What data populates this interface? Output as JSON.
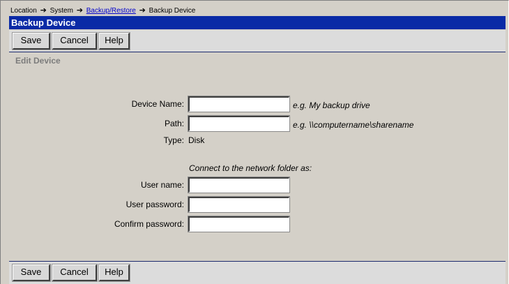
{
  "breadcrumb": {
    "location": "Location",
    "system": "System",
    "backup_restore": "Backup/Restore",
    "current": "Backup Device"
  },
  "title": "Backup Device",
  "toolbar": {
    "save_label": "Save",
    "cancel_label": "Cancel",
    "help_label": "Help"
  },
  "section_title": "Edit Device",
  "form": {
    "device_name": {
      "label": "Device Name:",
      "value": "",
      "hint": "e.g. My backup drive"
    },
    "path": {
      "label": "Path:",
      "value": "",
      "hint": "e.g. \\\\computername\\sharename"
    },
    "type": {
      "label": "Type:",
      "value": "Disk"
    },
    "connect_caption": "Connect to the network folder as:",
    "user_name": {
      "label": "User name:",
      "value": ""
    },
    "user_password": {
      "label": "User password:",
      "value": ""
    },
    "confirm_password": {
      "label": "Confirm password:",
      "value": ""
    }
  },
  "colors": {
    "background": "#d4d0c8",
    "titlebar": "#0a2aa6",
    "link": "#0000cc",
    "section_title": "#7c7c7c"
  },
  "icons": {
    "breadcrumb_separator": "arrow-right-icon"
  }
}
